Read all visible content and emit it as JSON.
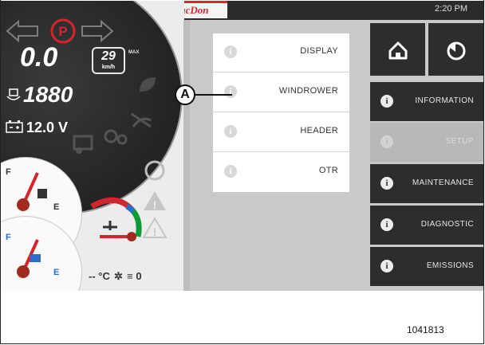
{
  "header": {
    "brand": "MacDon",
    "time": "2:20 PM"
  },
  "dashboard": {
    "park_indicator": "P",
    "speed": "0.0",
    "speed_limit": "29",
    "speed_unit": "km/h",
    "max_label": "MAX",
    "engine_rpm": "1880",
    "battery_voltage": "12.0 V",
    "fuel_gauge": {
      "full": "F",
      "empty": "E"
    },
    "def_gauge": {
      "full": "F",
      "empty": "E"
    },
    "temperature_text": "-- °C",
    "defrost_text": "0"
  },
  "submenu": {
    "items": [
      {
        "label": "DISPLAY"
      },
      {
        "label": "WINDROWER"
      },
      {
        "label": "HEADER"
      },
      {
        "label": "OTR"
      }
    ]
  },
  "main_menu": {
    "home_icon": "home-icon",
    "back_icon": "back-icon",
    "items": [
      {
        "label": "INFORMATION",
        "active": false
      },
      {
        "label": "SETUP",
        "active": true
      },
      {
        "label": "MAINTENANCE",
        "active": false
      },
      {
        "label": "DIAGNOSTIC",
        "active": false
      },
      {
        "label": "EMISSIONS",
        "active": false
      }
    ]
  },
  "callout": {
    "letter": "A"
  },
  "figure_number": "1041813",
  "colors": {
    "brand_red": "#d2262f",
    "menu_dark": "#2d2d2d",
    "menu_active": "#b8b8b8",
    "background": "#c9c9c9"
  }
}
